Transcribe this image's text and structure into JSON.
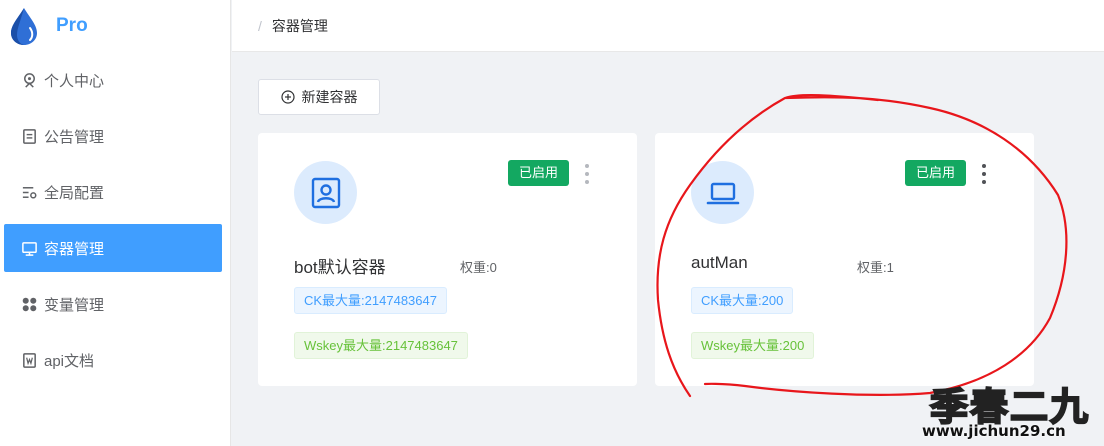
{
  "app": {
    "logo_text": "Pro"
  },
  "sidebar": {
    "items": [
      {
        "label": "个人中心",
        "icon": "user-center-icon",
        "active": false
      },
      {
        "label": "公告管理",
        "icon": "announcement-icon",
        "active": false
      },
      {
        "label": "全局配置",
        "icon": "global-config-icon",
        "active": false
      },
      {
        "label": "容器管理",
        "icon": "monitor-icon",
        "active": true
      },
      {
        "label": "变量管理",
        "icon": "variables-icon",
        "active": false
      },
      {
        "label": "api文档",
        "icon": "document-icon",
        "active": false
      }
    ]
  },
  "breadcrumb": {
    "separator": "/",
    "current": "容器管理"
  },
  "main": {
    "new_button_label": "新建容器",
    "cards": [
      {
        "name": "bot默认容器",
        "weight": "权重:0",
        "status": "已启用",
        "ck": "CK最大量:2147483647",
        "wskey": "Wskey最大量:2147483647",
        "icon": "user-profile-icon"
      },
      {
        "name": "autMan",
        "weight": "权重:1",
        "status": "已启用",
        "ck": "CK最大量:200",
        "wskey": "Wskey最大量:200",
        "icon": "laptop-icon"
      }
    ]
  },
  "watermark": {
    "title": "季春二九",
    "url": "www.jichun29.cn"
  },
  "colors": {
    "accent": "#409eff",
    "status_green": "#13a861",
    "annotation_red": "#e8161b"
  }
}
